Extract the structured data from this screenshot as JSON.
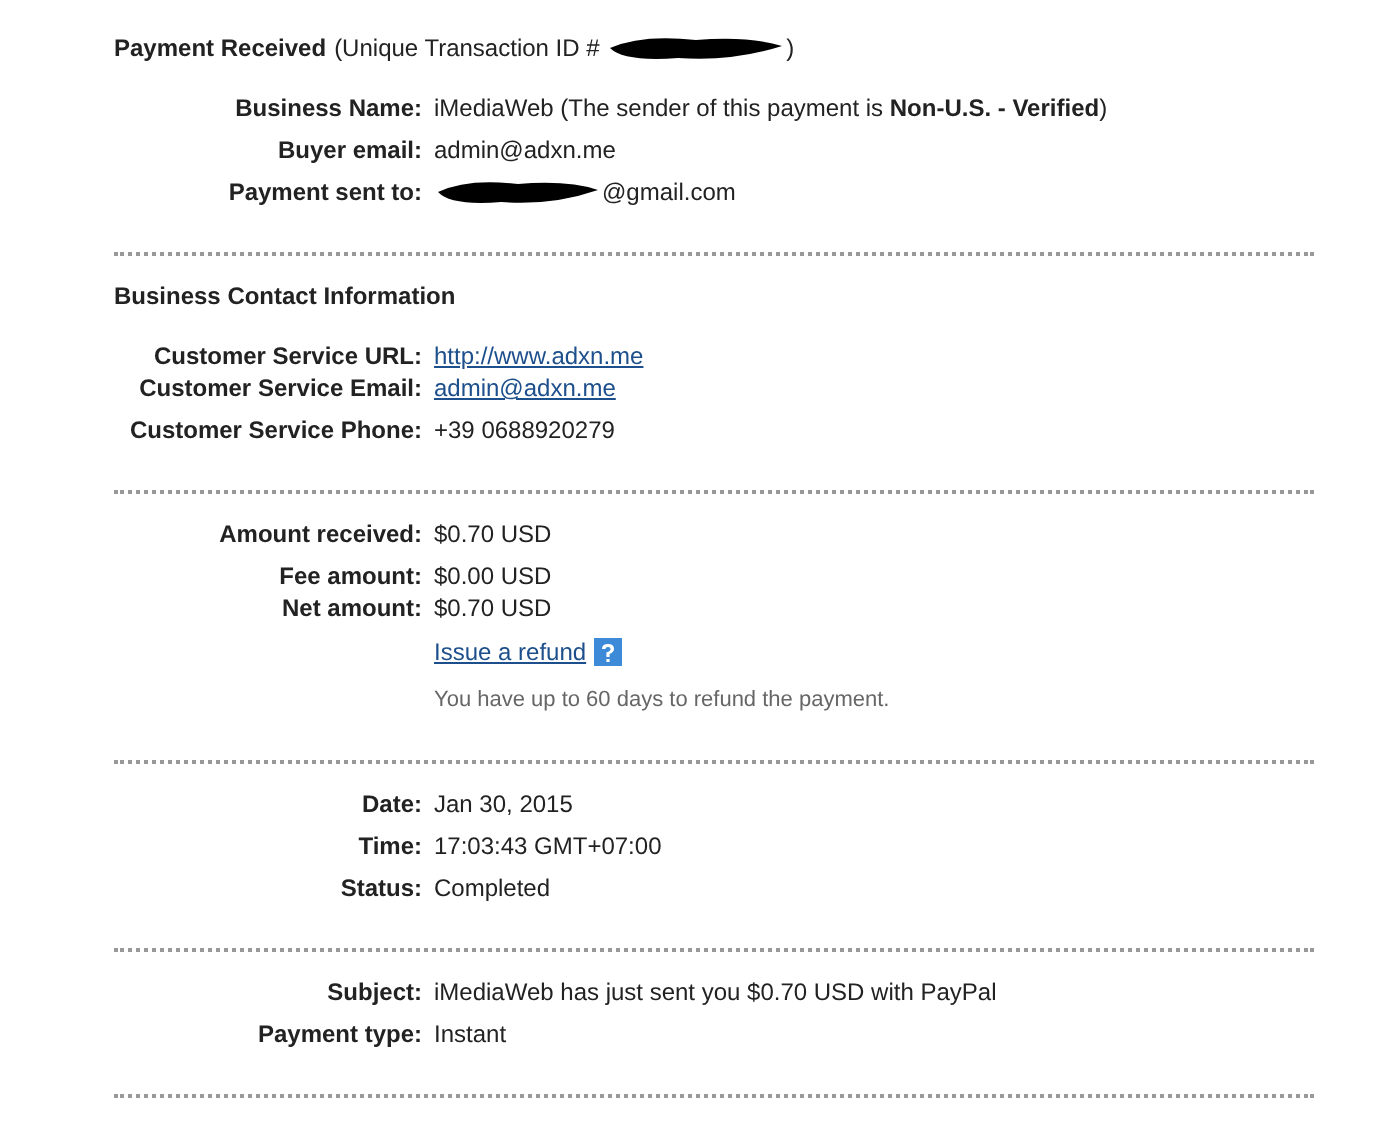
{
  "sections": [
    {
      "heading": {
        "title": "Payment Received",
        "note_start": "(Unique Transaction ID #",
        "note_end": ")",
        "redacted": true
      },
      "groups": [
        [
          {
            "label": "Business Name:",
            "kind": "text",
            "value": "iMediaWeb (The sender of this payment is **Non-U.S. - Verified**)"
          }
        ],
        [
          {
            "label": "Buyer email:",
            "kind": "text",
            "value": "admin@adxn.me"
          }
        ],
        [
          {
            "label": "Payment sent to:",
            "kind": "redacted",
            "value": "@gmail.com"
          }
        ]
      ]
    },
    {
      "heading": {
        "title": "Business Contact Information"
      },
      "groups": [
        [
          {
            "label": "Customer Service URL:",
            "kind": "link",
            "value": "http://www.adxn.me"
          },
          {
            "label": "Customer Service Email:",
            "kind": "link",
            "value": "admin@adxn.me"
          }
        ],
        [
          {
            "label": "Customer Service Phone:",
            "kind": "text",
            "value": "+39 0688920279"
          }
        ]
      ]
    },
    {
      "groups": [
        [
          {
            "label": "Amount received:",
            "kind": "text",
            "value": "$0.70 USD"
          }
        ],
        [
          {
            "label": "Fee amount:",
            "kind": "text",
            "value": "$0.00 USD"
          },
          {
            "label": "Net amount:",
            "kind": "text",
            "value": "$0.70 USD"
          },
          {
            "kind": "refund",
            "value": "Issue a refund",
            "note": "You have up to 60 days to refund the payment."
          }
        ]
      ]
    },
    {
      "groups": [
        [
          {
            "label": "Date:",
            "kind": "text",
            "value": "Jan 30, 2015"
          }
        ],
        [
          {
            "label": "Time:",
            "kind": "text",
            "value": "17:03:43 GMT+07:00"
          }
        ],
        [
          {
            "label": "Status:",
            "kind": "text",
            "value": "Completed"
          }
        ]
      ]
    },
    {
      "groups": [
        [
          {
            "label": "Subject:",
            "kind": "text",
            "value": "iMediaWeb has just sent you $0.70 USD with PayPal"
          }
        ],
        [
          {
            "label": "Payment type:",
            "kind": "text",
            "value": "Instant"
          }
        ]
      ]
    }
  ]
}
